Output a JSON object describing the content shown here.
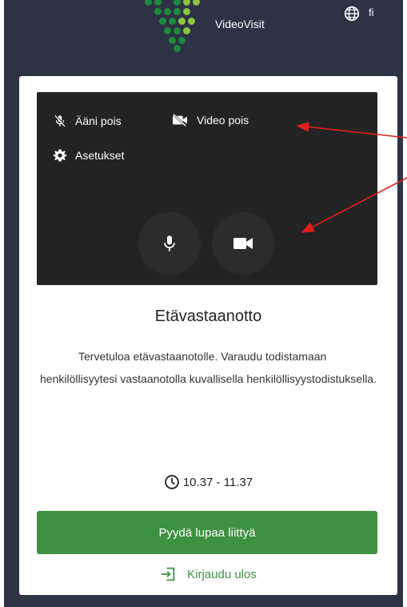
{
  "header": {
    "brand_name": "VideoVisit",
    "language_code": "fi",
    "logo_colors": [
      "#1e8a3c",
      "#8dc63f"
    ]
  },
  "video_panel": {
    "mute_audio_label": "Ääni pois",
    "mute_video_label": "Video pois",
    "settings_label": "Asetukset",
    "icons": [
      "mic-off-icon",
      "video-off-icon",
      "gear-icon",
      "mic-icon",
      "video-camera-icon"
    ]
  },
  "main": {
    "title": "Etävastaanotto",
    "description": "Tervetuloa etävastaanotolle. Varaudu todistamaan henkilöllisyytesi vastaanotolla kuvallisella henkilöllisyystodistuksella.",
    "time_range": "10.37 - 11.37",
    "request_join_label": "Pyydä lupaa liittyä",
    "logout_label": "Kirjaudu ulos"
  },
  "colors": {
    "background": "#2d3245",
    "accent_green": "#3d9140",
    "video_panel": "#232323",
    "annotation_arrow": "#e0201b"
  }
}
